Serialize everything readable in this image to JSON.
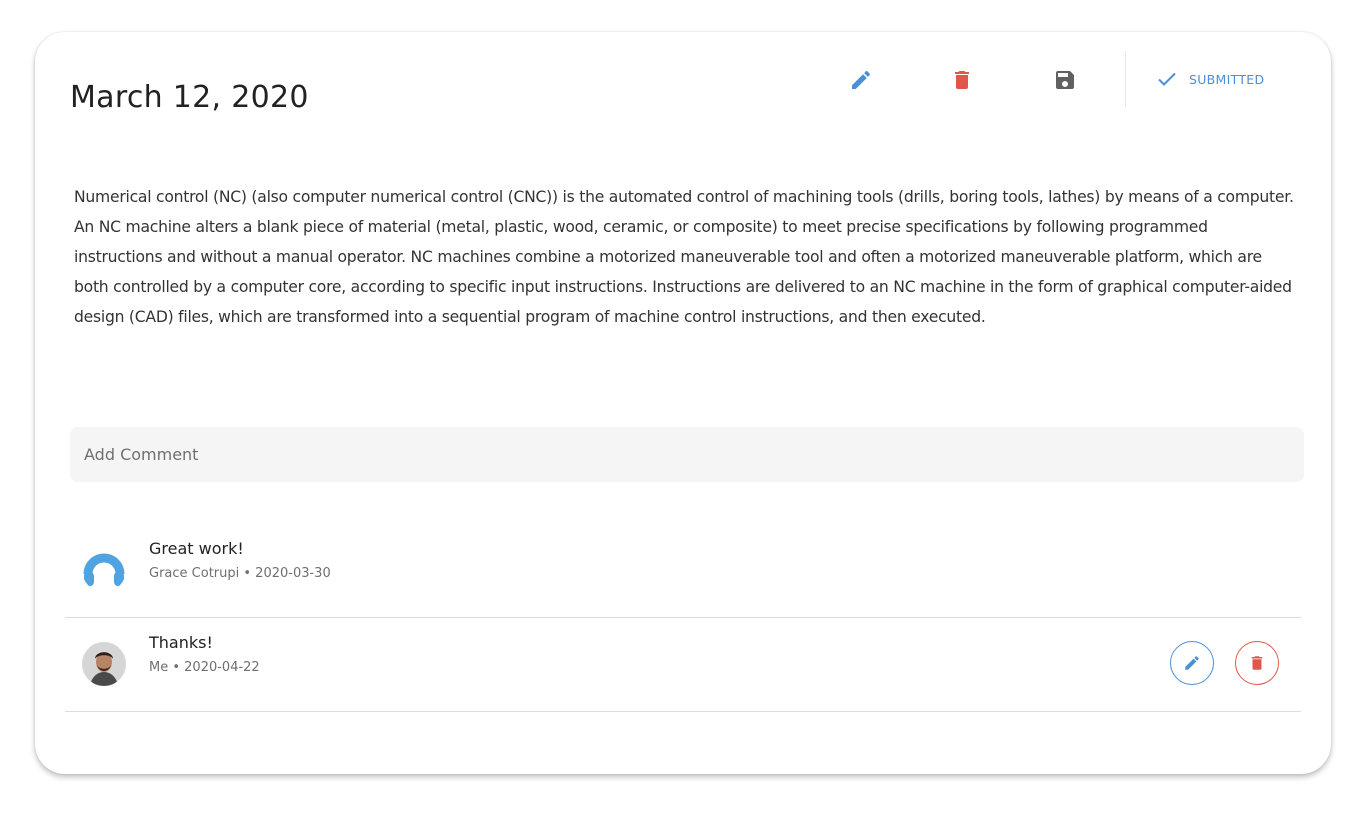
{
  "entry": {
    "title": "March 12, 2020",
    "body": "Numerical control (NC) (also computer numerical control (CNC)) is the automated control of machining tools (drills, boring tools, lathes) by means of a computer. An NC machine alters a blank piece of material (metal, plastic, wood, ceramic, or composite) to meet precise specifications by following programmed instructions and without a manual operator. NC machines combine a motorized maneuverable tool and often a motorized maneuverable platform, which are both controlled by a computer core, according to specific input instructions. Instructions are delivered to an NC machine in the form of graphical computer-aided design (CAD) files, which are transformed into a sequential program of machine control instructions, and then executed."
  },
  "toolbar": {
    "edit_icon": "pencil-icon",
    "delete_icon": "trash-icon",
    "save_icon": "floppy-disk-icon",
    "status_icon": "checkmark-icon",
    "status_label": "SUBMITTED"
  },
  "comment_input": {
    "placeholder": "Add Comment",
    "value": ""
  },
  "comments": [
    {
      "text": "Great work!",
      "author": "Grace Cotrupi",
      "date": "2020-03-30",
      "meta": "Grace Cotrupi • 2020-03-30",
      "avatar": "headphones-avatar"
    },
    {
      "text": "Thanks!",
      "author": "Me",
      "date": "2020-04-22",
      "meta": "Me • 2020-04-22",
      "avatar": "user-photo-avatar",
      "actions": [
        "edit",
        "delete"
      ]
    }
  ],
  "colors": {
    "primary_blue": "#4a8fd8",
    "danger_red": "#e0574a",
    "save_gray": "#616161",
    "input_bg": "#f5f5f5",
    "avatar_blue": "#4fa3e0"
  }
}
